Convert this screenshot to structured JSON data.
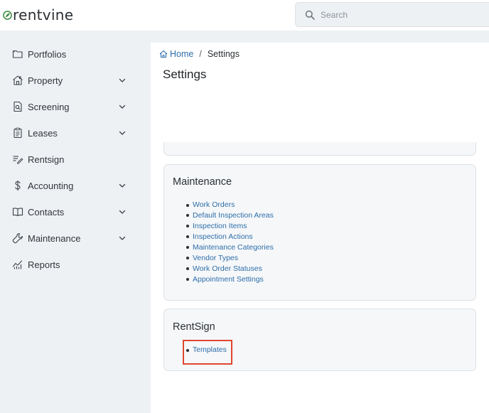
{
  "brand": {
    "name": "rentvine",
    "leaf_color": "#3a8a3e"
  },
  "search": {
    "placeholder": "Search",
    "icon": "search-icon"
  },
  "sidebar": {
    "items": [
      {
        "label": "Portfolios",
        "icon": "folder-icon",
        "has_chevron": false
      },
      {
        "label": "Property",
        "icon": "property-icon",
        "has_chevron": true
      },
      {
        "label": "Screening",
        "icon": "screening-icon",
        "has_chevron": true
      },
      {
        "label": "Leases",
        "icon": "clipboard-icon",
        "has_chevron": true
      },
      {
        "label": "Rentsign",
        "icon": "signature-icon",
        "has_chevron": false
      },
      {
        "label": "Accounting",
        "icon": "dollar-icon",
        "has_chevron": true
      },
      {
        "label": "Contacts",
        "icon": "book-icon",
        "has_chevron": true
      },
      {
        "label": "Maintenance",
        "icon": "wrench-icon",
        "has_chevron": true
      },
      {
        "label": "Reports",
        "icon": "chart-icon",
        "has_chevron": false
      }
    ]
  },
  "breadcrumb": {
    "home": "Home",
    "separator": "/",
    "current": "Settings"
  },
  "page": {
    "title": "Settings"
  },
  "sections": {
    "maintenance": {
      "title": "Maintenance",
      "links": [
        "Work Orders",
        "Default Inspection Areas",
        "Inspection Items",
        "Inspection Actions",
        "Maintenance Categories",
        "Vendor Types",
        "Work Order Statuses",
        "Appointment Settings"
      ]
    },
    "rentsign": {
      "title": "RentSign",
      "links": [
        "Templates"
      ]
    }
  },
  "colors": {
    "link": "#2f6ea9",
    "highlight": "#e0472f",
    "sidebar_bg": "#eef1f4",
    "card_bg": "#f5f7f9"
  }
}
